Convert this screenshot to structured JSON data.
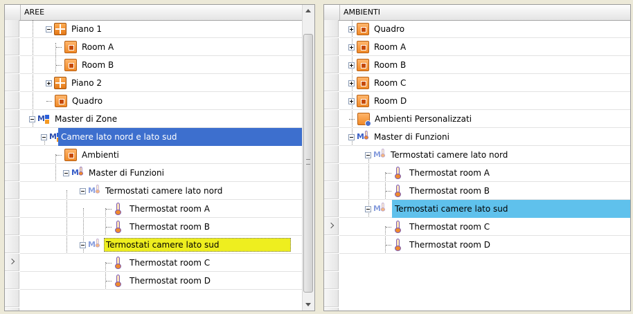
{
  "left": {
    "header": "AREE",
    "rows": [
      {
        "label": "Piano 1"
      },
      {
        "label": "Room A"
      },
      {
        "label": "Room B"
      },
      {
        "label": "Piano 2"
      },
      {
        "label": "Quadro"
      },
      {
        "label": "Master di Zone"
      },
      {
        "label": "Camere lato nord e lato sud"
      },
      {
        "label": "Ambienti"
      },
      {
        "label": "Master di Funzioni"
      },
      {
        "label": "Termostati camere lato nord"
      },
      {
        "label": "Thermostat room A"
      },
      {
        "label": "Thermostat room B"
      },
      {
        "label": "Termostati camere lato sud"
      },
      {
        "label": "Thermostat room C"
      },
      {
        "label": "Thermostat room D"
      }
    ]
  },
  "right": {
    "header": "AMBIENTI",
    "rows": [
      {
        "label": "Quadro"
      },
      {
        "label": "Room A"
      },
      {
        "label": "Room B"
      },
      {
        "label": "Room C"
      },
      {
        "label": "Room D"
      },
      {
        "label": "Ambienti Personalizzati"
      },
      {
        "label": "Master di Funzioni"
      },
      {
        "label": "Termostati camere lato nord"
      },
      {
        "label": "Thermostat room A"
      },
      {
        "label": "Thermostat room B"
      },
      {
        "label": "Termostati camere lato sud"
      },
      {
        "label": "Thermostat room C"
      },
      {
        "label": "Thermostat room D"
      }
    ]
  },
  "colors": {
    "selection_blue": "#3d6fce",
    "selection_yellow": "#eeee1f",
    "selection_light_blue": "#5fc1ec",
    "room_orange": "#f08a2a"
  }
}
